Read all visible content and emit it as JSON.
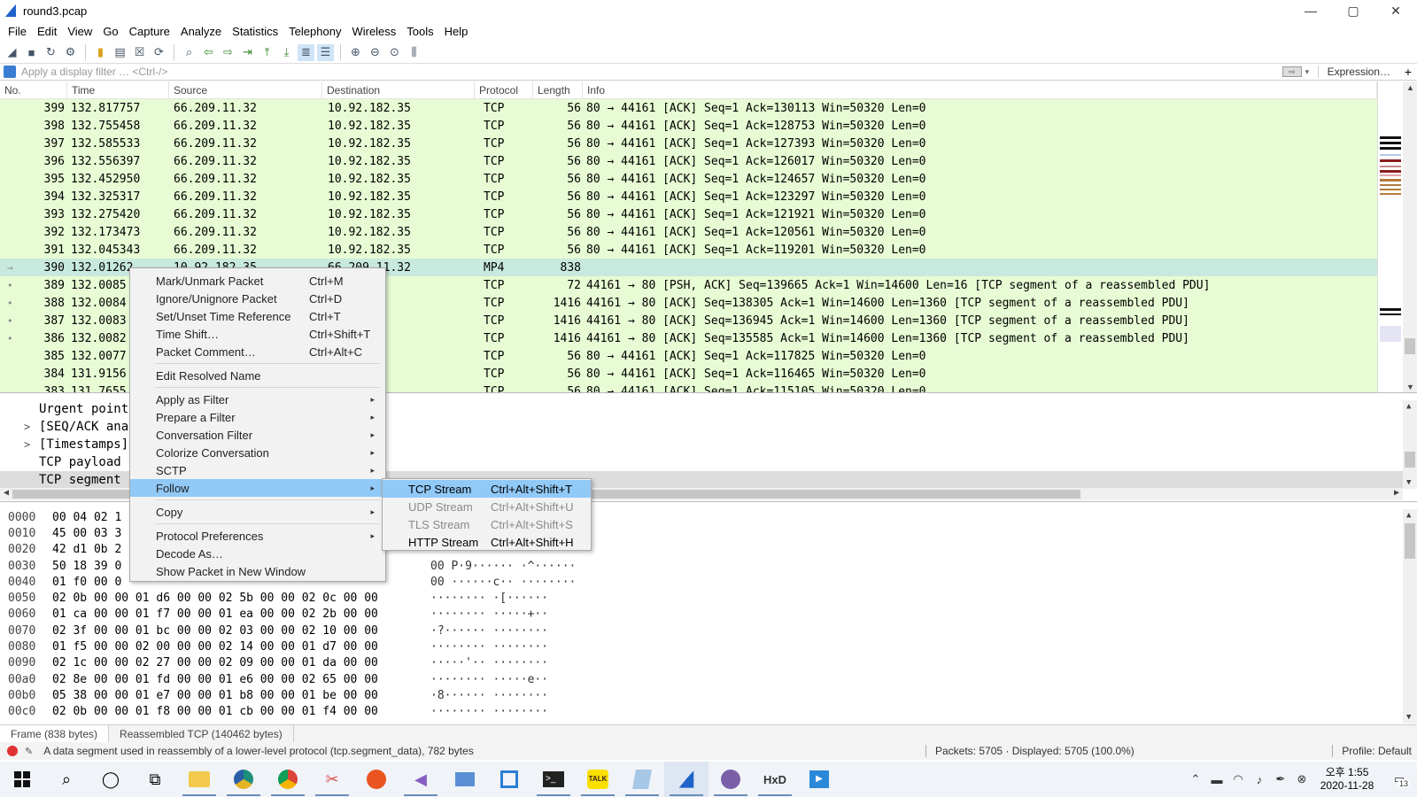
{
  "window": {
    "title": "round3.pcap",
    "min": "—",
    "max": "▢",
    "close": "✕"
  },
  "menu": [
    "File",
    "Edit",
    "View",
    "Go",
    "Capture",
    "Analyze",
    "Statistics",
    "Telephony",
    "Wireless",
    "Tools",
    "Help"
  ],
  "filter": {
    "placeholder": "Apply a display filter … <Ctrl-/>",
    "expression_label": "Expression…",
    "plus": "+"
  },
  "columns": [
    "No.",
    "Time",
    "Source",
    "Destination",
    "Protocol",
    "Length",
    "Info"
  ],
  "packets": [
    {
      "no": "399",
      "time": "132.817757",
      "src": "66.209.11.32",
      "dst": "10.92.182.35",
      "proto": "TCP",
      "len": "56",
      "info": "80 → 44161 [ACK] Seq=1 Ack=130113 Win=50320 Len=0"
    },
    {
      "no": "398",
      "time": "132.755458",
      "src": "66.209.11.32",
      "dst": "10.92.182.35",
      "proto": "TCP",
      "len": "56",
      "info": "80 → 44161 [ACK] Seq=1 Ack=128753 Win=50320 Len=0"
    },
    {
      "no": "397",
      "time": "132.585533",
      "src": "66.209.11.32",
      "dst": "10.92.182.35",
      "proto": "TCP",
      "len": "56",
      "info": "80 → 44161 [ACK] Seq=1 Ack=127393 Win=50320 Len=0"
    },
    {
      "no": "396",
      "time": "132.556397",
      "src": "66.209.11.32",
      "dst": "10.92.182.35",
      "proto": "TCP",
      "len": "56",
      "info": "80 → 44161 [ACK] Seq=1 Ack=126017 Win=50320 Len=0"
    },
    {
      "no": "395",
      "time": "132.452950",
      "src": "66.209.11.32",
      "dst": "10.92.182.35",
      "proto": "TCP",
      "len": "56",
      "info": "80 → 44161 [ACK] Seq=1 Ack=124657 Win=50320 Len=0"
    },
    {
      "no": "394",
      "time": "132.325317",
      "src": "66.209.11.32",
      "dst": "10.92.182.35",
      "proto": "TCP",
      "len": "56",
      "info": "80 → 44161 [ACK] Seq=1 Ack=123297 Win=50320 Len=0"
    },
    {
      "no": "393",
      "time": "132.275420",
      "src": "66.209.11.32",
      "dst": "10.92.182.35",
      "proto": "TCP",
      "len": "56",
      "info": "80 → 44161 [ACK] Seq=1 Ack=121921 Win=50320 Len=0"
    },
    {
      "no": "392",
      "time": "132.173473",
      "src": "66.209.11.32",
      "dst": "10.92.182.35",
      "proto": "TCP",
      "len": "56",
      "info": "80 → 44161 [ACK] Seq=1 Ack=120561 Win=50320 Len=0"
    },
    {
      "no": "391",
      "time": "132.045343",
      "src": "66.209.11.32",
      "dst": "10.92.182.35",
      "proto": "TCP",
      "len": "56",
      "info": "80 → 44161 [ACK] Seq=1 Ack=119201 Win=50320 Len=0"
    },
    {
      "no": "390",
      "time": "132.01262",
      "src": "10.92.182.35",
      "dst": "66.209.11.32",
      "proto": "MP4",
      "len": "838",
      "info": ""
    },
    {
      "no": "389",
      "time": "132.0085",
      "src": "",
      "dst": "1.32",
      "proto": "TCP",
      "len": "72",
      "info": "44161 → 80 [PSH, ACK] Seq=139665 Ack=1 Win=14600 Len=16 [TCP segment of a reassembled PDU]"
    },
    {
      "no": "388",
      "time": "132.0084",
      "src": "",
      "dst": "1.32",
      "proto": "TCP",
      "len": "1416",
      "info": "44161 → 80 [ACK] Seq=138305 Ack=1 Win=14600 Len=1360 [TCP segment of a reassembled PDU]"
    },
    {
      "no": "387",
      "time": "132.0083",
      "src": "",
      "dst": "1.32",
      "proto": "TCP",
      "len": "1416",
      "info": "44161 → 80 [ACK] Seq=136945 Ack=1 Win=14600 Len=1360 [TCP segment of a reassembled PDU]"
    },
    {
      "no": "386",
      "time": "132.0082",
      "src": "",
      "dst": "1.32",
      "proto": "TCP",
      "len": "1416",
      "info": "44161 → 80 [ACK] Seq=135585 Ack=1 Win=14600 Len=1360 [TCP segment of a reassembled PDU]"
    },
    {
      "no": "385",
      "time": "132.0077",
      "src": "",
      "dst": "32.35",
      "proto": "TCP",
      "len": "56",
      "info": "80 → 44161 [ACK] Seq=1 Ack=117825 Win=50320 Len=0"
    },
    {
      "no": "384",
      "time": "131.9156",
      "src": "",
      "dst": "32.35",
      "proto": "TCP",
      "len": "56",
      "info": "80 → 44161 [ACK] Seq=1 Ack=116465 Win=50320 Len=0"
    },
    {
      "no": "383",
      "time": "131.7655",
      "src": "",
      "dst": "32.35",
      "proto": "TCP",
      "len": "56",
      "info": "80 → 44161 [ACK] Seq=1 Ack=115105 Win=50320 Len=0"
    }
  ],
  "details": [
    {
      "text": "Urgent point",
      "expander": ""
    },
    {
      "text": "[SEQ/ACK ana",
      "expander": ">"
    },
    {
      "text": "[Timestamps]",
      "expander": ">"
    },
    {
      "text": "TCP payload",
      "expander": ""
    },
    {
      "text": "TCP segment",
      "expander": ""
    }
  ],
  "bytes": [
    {
      "off": "0000",
      "hex": "00 04 02 1",
      "ascii": ""
    },
    {
      "off": "0010",
      "hex": "45 00 03 3",
      "ascii": ""
    },
    {
      "off": "0020",
      "hex": "42 d1 0b 2",
      "ascii": ""
    },
    {
      "off": "0030",
      "hex": "50 18 39 0",
      "ascii": "00   P·9······  ·^······"
    },
    {
      "off": "0040",
      "hex": "01 f0 00 0",
      "ascii": "00   ······c··  ········"
    },
    {
      "off": "0050",
      "hex": "02 0b 00 00 01 d6 00 00   02 5b 00 00 02 0c 00 00",
      "ascii": "········  ·[······"
    },
    {
      "off": "0060",
      "hex": "01 ca 00 00 01 f7 00 00   01 ea 00 00 02 2b 00 00",
      "ascii": "········  ·····+··"
    },
    {
      "off": "0070",
      "hex": "02 3f 00 00 01 bc 00 00   02 03 00 00 02 10 00 00",
      "ascii": "·?······  ········"
    },
    {
      "off": "0080",
      "hex": "01 f5 00 00 02 00 00 00   02 14 00 00 01 d7 00 00",
      "ascii": "········  ········"
    },
    {
      "off": "0090",
      "hex": "02 1c 00 00 02 27 00 00   02 09 00 00 01 da 00 00",
      "ascii": "·····'··  ········"
    },
    {
      "off": "00a0",
      "hex": "02 8e 00 00 01 fd 00 00   01 e6 00 00 02 65 00 00",
      "ascii": "········  ·····e··"
    },
    {
      "off": "00b0",
      "hex": "05 38 00 00 01 e7 00 00   01 b8 00 00 01 be 00 00",
      "ascii": "·8······  ········"
    },
    {
      "off": "00c0",
      "hex": "02 0b 00 00 01 f8 00 00   01 cb 00 00 01 f4 00 00",
      "ascii": "········  ········"
    }
  ],
  "byte_tabs": [
    "Frame (838 bytes)",
    "Reassembled TCP (140462 bytes)"
  ],
  "status": {
    "message": "A data segment used in reassembly of a lower-level protocol (tcp.segment_data), 782 bytes",
    "packets": "Packets: 5705 · Displayed: 5705 (100.0%)",
    "profile": "Profile: Default"
  },
  "context_menu": [
    {
      "label": "Mark/Unmark Packet",
      "shortcut": "Ctrl+M"
    },
    {
      "label": "Ignore/Unignore Packet",
      "shortcut": "Ctrl+D"
    },
    {
      "label": "Set/Unset Time Reference",
      "shortcut": "Ctrl+T"
    },
    {
      "label": "Time Shift…",
      "shortcut": "Ctrl+Shift+T"
    },
    {
      "label": "Packet Comment…",
      "shortcut": "Ctrl+Alt+C"
    },
    {
      "label": "Edit Resolved Name",
      "shortcut": ""
    },
    {
      "label": "Apply as Filter",
      "shortcut": ""
    },
    {
      "label": "Prepare a Filter",
      "shortcut": ""
    },
    {
      "label": "Conversation Filter",
      "shortcut": ""
    },
    {
      "label": "Colorize Conversation",
      "shortcut": ""
    },
    {
      "label": "SCTP",
      "shortcut": ""
    },
    {
      "label": "Follow",
      "shortcut": ""
    },
    {
      "label": "Copy",
      "shortcut": ""
    },
    {
      "label": "Protocol Preferences",
      "shortcut": ""
    },
    {
      "label": "Decode As…",
      "shortcut": ""
    },
    {
      "label": "Show Packet in New Window",
      "shortcut": ""
    }
  ],
  "follow_submenu": [
    {
      "label": "TCP Stream",
      "shortcut": "Ctrl+Alt+Shift+T"
    },
    {
      "label": "UDP Stream",
      "shortcut": "Ctrl+Alt+Shift+U"
    },
    {
      "label": "TLS Stream",
      "shortcut": "Ctrl+Alt+Shift+S"
    },
    {
      "label": "HTTP Stream",
      "shortcut": "Ctrl+Alt+Shift+H"
    }
  ],
  "taskbar": {
    "icons": [
      "windows-start-icon",
      "search-icon",
      "cortana-icon",
      "task-view-icon",
      "file-explorer-icon",
      "chrome-canary-icon",
      "chrome-icon",
      "snipping-icon",
      "ubuntu-icon",
      "visual-studio-icon",
      "network-folder-icon",
      "remote-desktop-icon",
      "terminal-icon",
      "kakaotalk-icon",
      "notepad-icon",
      "wireshark-icon",
      "app-icon",
      "hxd-icon",
      "media-icon"
    ],
    "kakao_label": "TALK",
    "hxd_label": "HxD",
    "clock_time": "오후 1:55",
    "clock_date": "2020-11-28",
    "notif_count": "13"
  },
  "colors": {
    "row_bg": "#e7fbd4",
    "row_selected": "#c8e9de",
    "menu_highlight": "#91c9f7",
    "wireshark_blue": "#1e63c8"
  }
}
